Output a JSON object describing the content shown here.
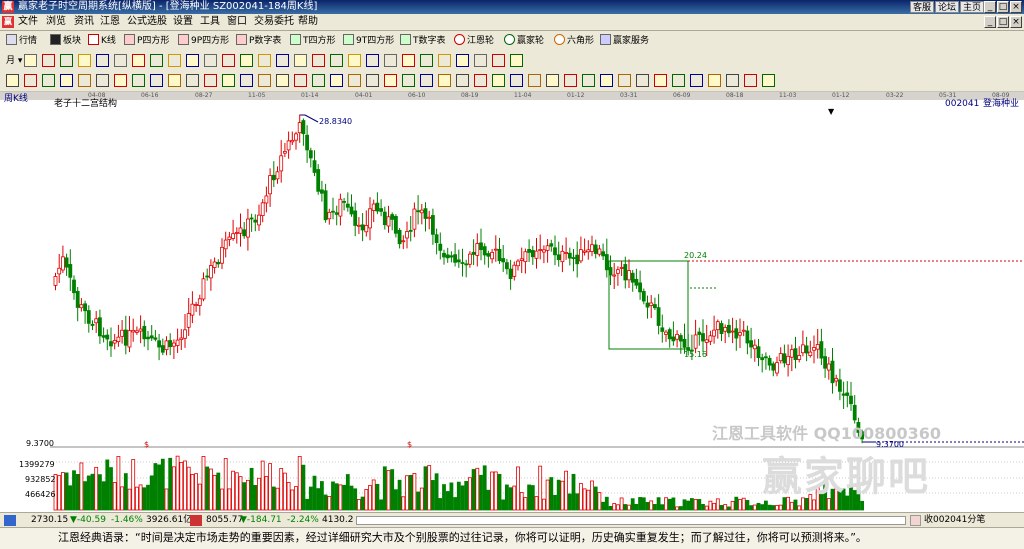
{
  "window": {
    "title": "赢家老子时空周期系统[纵横版] - [登海种业  SZ002041-184周K线]",
    "links": [
      "客服",
      "论坛",
      "主页"
    ],
    "controls": [
      "_",
      "□",
      "×"
    ]
  },
  "menu": {
    "items": [
      "文件",
      "浏览",
      "资讯",
      "江恩",
      "公式选股",
      "设置",
      "工具",
      "窗口",
      "交易委托",
      "帮助"
    ]
  },
  "toolbar1": {
    "items": [
      "行情",
      "板块",
      "K线",
      "P四方形",
      "9P四方形",
      "P数字表",
      "T四方形",
      "9T四方形",
      "T数字表",
      "江恩轮",
      "赢家轮",
      "六角形",
      "赢家服务"
    ]
  },
  "toolbar2": {
    "period": "月"
  },
  "date_axis": [
    "04-08",
    "06-16",
    "08-27",
    "11-05",
    "01-14",
    "04-01",
    "06-10",
    "08-19",
    "11-04",
    "01-12",
    "03-31",
    "06-09",
    "08-18",
    "11-03",
    "01-12",
    "03-22",
    "05-31",
    "08-09"
  ],
  "chart": {
    "period_label": "周K线",
    "indicator_name": "老子十二宫结构",
    "stock_code": "002041",
    "stock_name": "登海种业",
    "high_label": "28.8340",
    "low_label": "9.3700",
    "box_top_label": "20.24",
    "box_bottom_label": "15.16",
    "vol_top_label": "9.3700",
    "dollar_mark": "$",
    "volume_ticks": [
      "1399279",
      "932852",
      "466426"
    ]
  },
  "watermark": {
    "line1": "江恩工具软件  QQ100800360",
    "line2": "赢家聊吧"
  },
  "status": {
    "sh_index": "2730.15",
    "sh_change": "▼-40.59",
    "sh_pct": "-1.46%",
    "sh_vol": "3926.61亿",
    "sz_index": "8055.77",
    "sz_change": "▼-184.71",
    "sz_pct": "-2.24%",
    "sz_vol": "4130.2",
    "right_text": "收002041分笔"
  },
  "quote": {
    "text": "江恩经典语录：“时间是决定市场走势的重要因素，经过详细研究大市及个别股票的过往记录，你将可以证明，历史确实重复发生；而了解过往，你将可以预测将来。”。"
  },
  "colors": {
    "up": "#e00000",
    "down": "#008000",
    "accent_line": "#000080",
    "titlebar": "#0a246a"
  }
}
